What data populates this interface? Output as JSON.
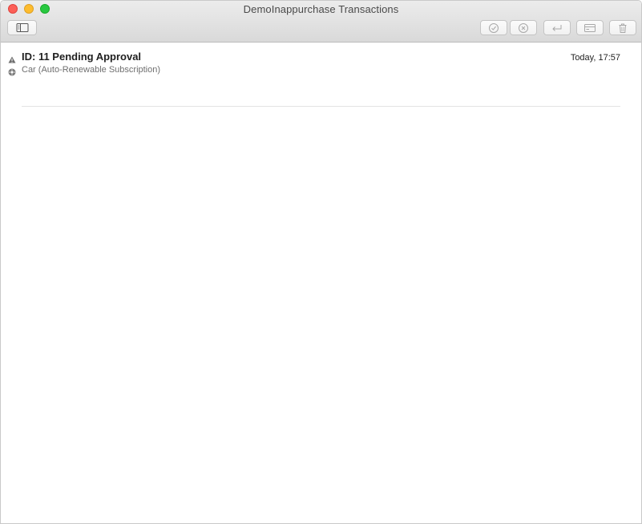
{
  "window": {
    "title": "DemoInappurchase Transactions"
  },
  "toolbar": {
    "buttons": [
      {
        "icon": "sidebar-toggle-icon"
      },
      {
        "icon": "checkmark-circle-icon"
      },
      {
        "icon": "x-circle-icon"
      },
      {
        "icon": "return-arrow-icon"
      },
      {
        "icon": "credit-card-icon"
      },
      {
        "icon": "trash-icon"
      }
    ]
  },
  "transactions": [
    {
      "title": "ID: 11 Pending Approval",
      "subtitle": "Car (Auto-Renewable Subscription)",
      "date": "Today, 17:57",
      "status_icon": "warning-triangle-icon",
      "type_icon": "gear-icon"
    }
  ],
  "colors": {
    "close": "#fc5f57",
    "minimize": "#fdbc2e",
    "zoom": "#28c840"
  }
}
